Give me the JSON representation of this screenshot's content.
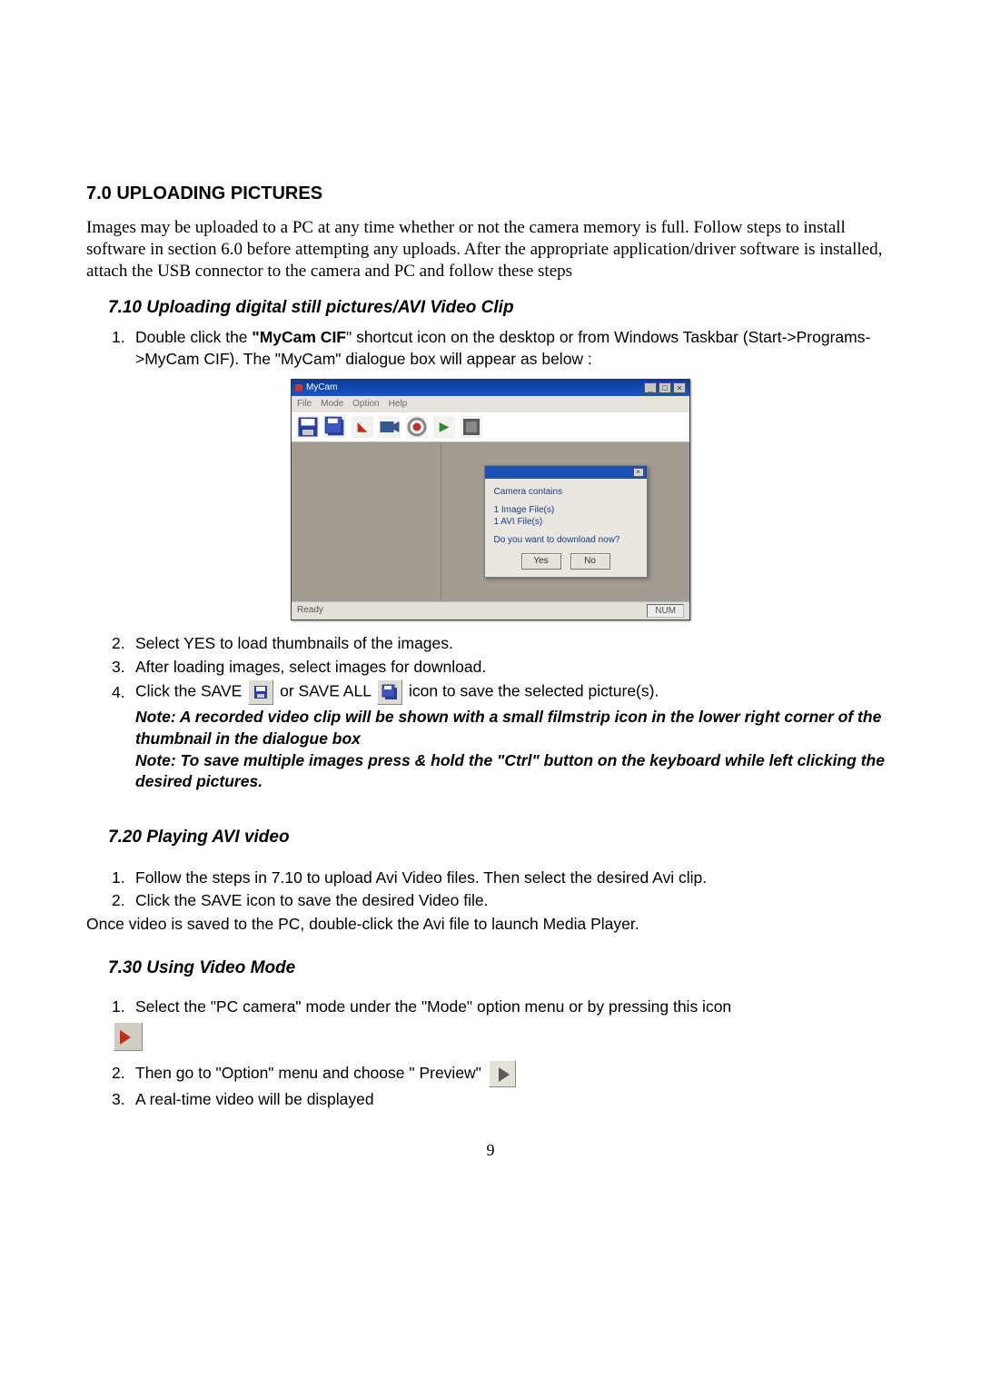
{
  "headings": {
    "main": "7.0 UPLOADING PICTURES",
    "s10": "7.10 Uploading digital still pictures/AVI Video Clip",
    "s20": "7.20 Playing AVI video",
    "s30": "7.30 Using Video Mode"
  },
  "intro": "Images may be uploaded to a PC at any time whether or not the camera memory is full.  Follow steps to install software in section 6.0 before attempting any uploads.  After the appropriate application/driver software is installed, attach the USB connector to the camera and PC and follow these steps",
  "s10": {
    "item1_pre": "Double click the ",
    "item1_bold": "\"MyCam CIF",
    "item1_post": "\" shortcut icon on the desktop or from Windows Taskbar (Start->Programs->MyCam CIF).  The \"MyCam\" dialogue box will appear as below :",
    "item2": "Select YES to load thumbnails of the images.",
    "item3": "After loading images, select images for download.",
    "item4_a": "Click the SAVE ",
    "item4_b": " or SAVE ALL",
    "item4_c": " icon to save the selected picture(s).",
    "note1": "Note: A recorded video clip will be shown with a small filmstrip icon in the lower right corner of the thumbnail in the dialogue box",
    "note2": "Note: To save multiple images press & hold the \"Ctrl\" button on the keyboard while left clicking the desired pictures."
  },
  "mycam": {
    "title": "MyCam",
    "menu": [
      "File",
      "Mode",
      "Option",
      "Help"
    ],
    "dlg": {
      "line1": "Camera contains",
      "line2": "1 Image File(s)",
      "line3": "1 AVI File(s)",
      "line4": "Do you want to download now?",
      "yes": "Yes",
      "no": "No"
    },
    "status_left": "Ready",
    "status_right": "NUM"
  },
  "s20": {
    "item1": "Follow the steps in 7.10 to upload Avi Video files. Then select the desired Avi clip.",
    "item2": "Click the SAVE icon to save the desired Video file.",
    "after": "Once video is saved to the PC, double-click the Avi file to launch Media Player."
  },
  "s30": {
    "item1": "Select the \"PC camera\" mode under the \"Mode\" option menu or by pressing this icon",
    "item2": "Then go to \"Option\" menu and choose \" Preview\"",
    "item3": "A real-time video will be displayed"
  },
  "nums": {
    "n1": "1.",
    "n2": "2.",
    "n3": "3.",
    "n4": "4."
  },
  "page_number": "9"
}
